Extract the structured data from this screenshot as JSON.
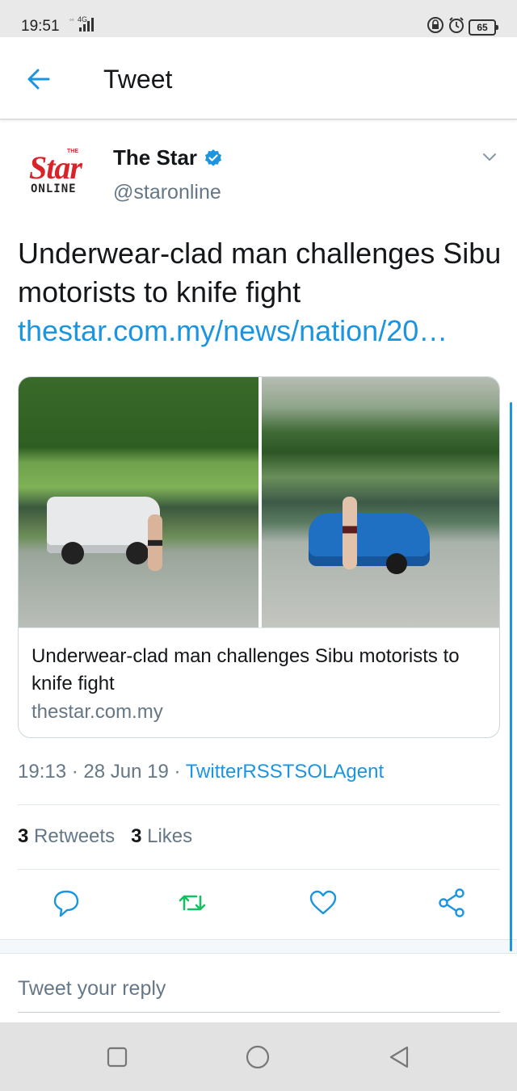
{
  "status_bar": {
    "time": "19:51",
    "network": "4G",
    "battery": "65"
  },
  "header": {
    "title": "Tweet",
    "back_icon": "arrow-left-icon"
  },
  "tweet": {
    "author": {
      "name": "The Star",
      "handle": "@staronline",
      "verified": true,
      "avatar": {
        "logo_small": "THE",
        "logo_main": "Star",
        "logo_sub": "ONLINE"
      }
    },
    "text": "Underwear-clad man challenges Sibu motorists to knife fight",
    "link": "thestar.com.my/news/nation/20…",
    "card": {
      "title": "Underwear-clad man challenges Sibu motorists to knife fight",
      "domain": "thestar.com.my"
    },
    "time": "19:13",
    "date": "28 Jun 19",
    "separator": " · ",
    "source": "TwitterRSSTSOLAgent",
    "stats": {
      "retweets_count": "3",
      "retweets_label": "Retweets",
      "likes_count": "3",
      "likes_label": "Likes"
    }
  },
  "actions": [
    "reply-icon",
    "retweet-icon",
    "like-icon",
    "share-icon"
  ],
  "reply": {
    "placeholder": "Tweet your reply"
  },
  "colors": {
    "accent": "#1b95e0",
    "retweet": "#17bf63",
    "secondary_text": "#657786",
    "brand_red": "#d9232b"
  }
}
